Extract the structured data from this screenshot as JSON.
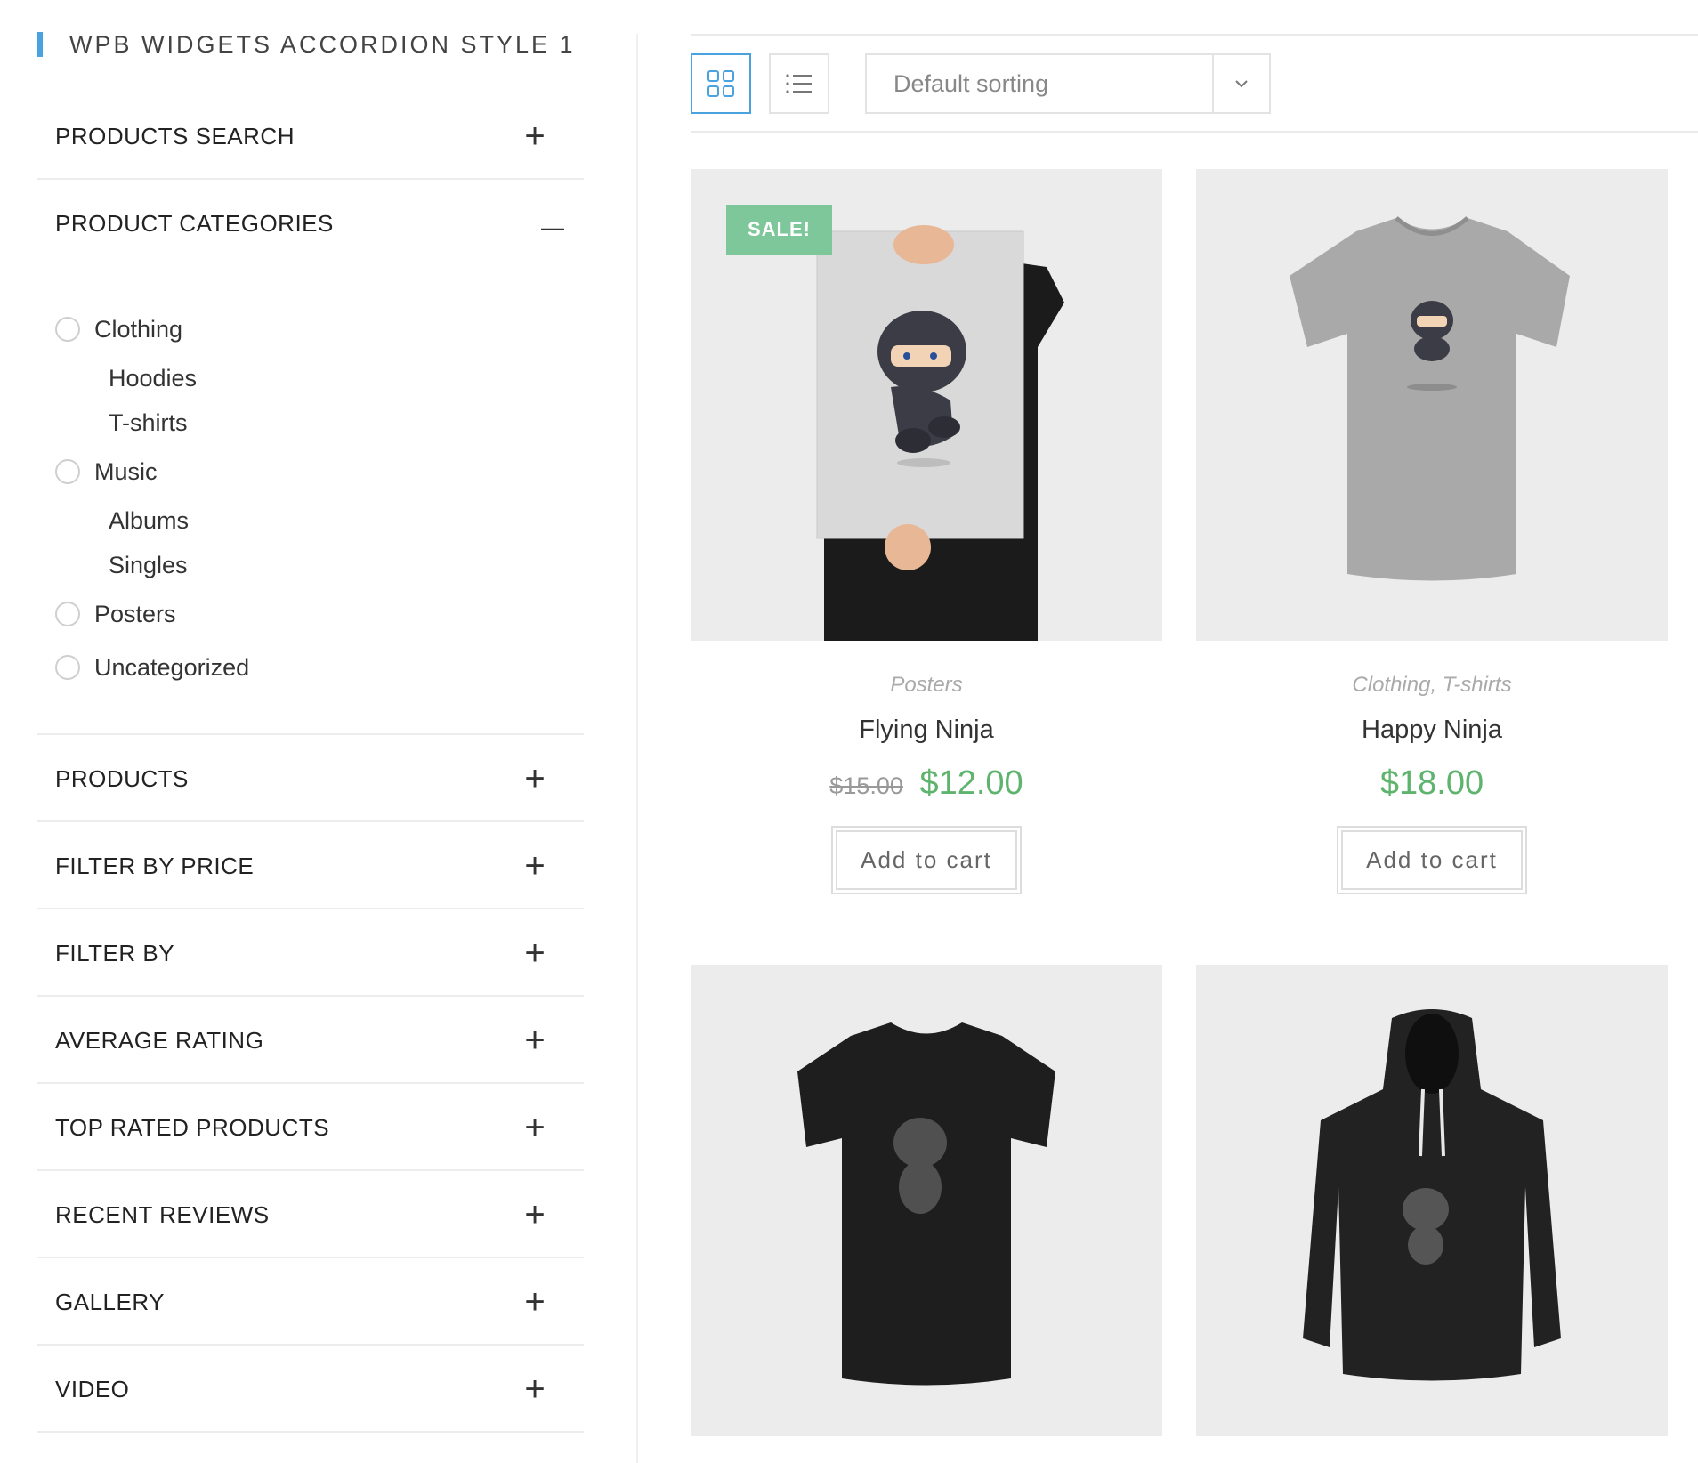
{
  "sidebar": {
    "title": "WPB WIDGETS ACCORDION STYLE 1",
    "sections": [
      {
        "label": "PRODUCTS SEARCH"
      },
      {
        "label": "PRODUCT CATEGORIES"
      },
      {
        "label": "PRODUCTS"
      },
      {
        "label": "FILTER BY PRICE"
      },
      {
        "label": "FILTER BY"
      },
      {
        "label": "AVERAGE RATING"
      },
      {
        "label": "TOP RATED PRODUCTS"
      },
      {
        "label": "RECENT REVIEWS"
      },
      {
        "label": "GALLERY"
      },
      {
        "label": "VIDEO"
      }
    ],
    "categories": {
      "clothing": "Clothing",
      "hoodies": "Hoodies",
      "tshirts": "T-shirts",
      "music": "Music",
      "albums": "Albums",
      "singles": "Singles",
      "posters": "Posters",
      "uncategorized": "Uncategorized"
    }
  },
  "toolbar": {
    "sort_value": "Default sorting",
    "grid_icon": "grid-view-icon",
    "list_icon": "list-view-icon"
  },
  "products": [
    {
      "category": "Posters",
      "title": "Flying Ninja",
      "old_price": "$15.00",
      "price": "$12.00",
      "badge": "SALE!",
      "cart_label": "Add to cart"
    },
    {
      "category": "Clothing, T-shirts",
      "title": "Happy Ninja",
      "price": "$18.00",
      "cart_label": "Add to cart"
    }
  ],
  "colors": {
    "accent": "#4aa3df",
    "price": "#5fb46d",
    "sale_badge": "#7ec79a"
  }
}
